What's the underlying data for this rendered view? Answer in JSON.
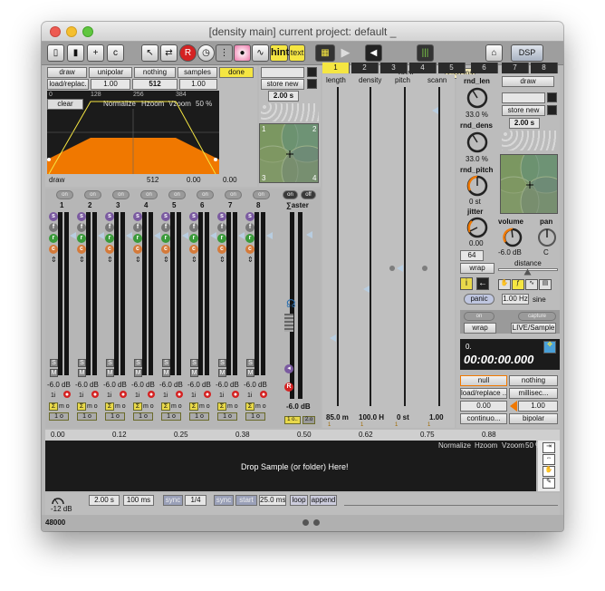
{
  "window": {
    "title": "[density main] current project:  default _"
  },
  "toolbar": {
    "hint": "hint",
    "text": "text",
    "post": "post",
    "post_ms": "25.0 ms",
    "dsp": "DSP"
  },
  "grain_panel": {
    "draw": "draw",
    "mode": "unipolar",
    "nothing": "nothing",
    "samples": "samples",
    "done": "done",
    "load_replace": "load/replac.",
    "value_1": "1.00",
    "value_512": "512",
    "value_1b": "1.00",
    "ruler": [
      "0",
      "128",
      "256",
      "384"
    ],
    "clear": "clear",
    "normalize": "Normalize",
    "hzoom": "Hzoom",
    "vzoom": "Vzoom",
    "zoom_pct": "50 %",
    "footer": [
      "draw",
      "512",
      "0.00",
      "0.00"
    ]
  },
  "preset_panel": {
    "store_new": "store new",
    "duration": "2.00 s",
    "corners": [
      "1",
      "2",
      "3",
      "4"
    ]
  },
  "param_tabs": [
    "1",
    "2",
    "3",
    "4",
    "5",
    "6",
    "7",
    "8"
  ],
  "params": {
    "names": [
      "length",
      "density",
      "pitch",
      "scann"
    ],
    "values": [
      "85.0 m",
      "100.0 H",
      "0 st",
      "1.00"
    ],
    "level": "1"
  },
  "mixer": {
    "on": "on",
    "off": "off",
    "master": "∑aster",
    "channels": [
      "1",
      "2",
      "3",
      "4",
      "5",
      "6",
      "7",
      "8"
    ],
    "levels": [
      "-6.0 dB",
      "-6.0 dB",
      "-6.0 dB",
      "-6.0 dB",
      "-6.0 dB",
      "-6.0 dB",
      "-6.0 dB",
      "-6.0 dB"
    ],
    "master_level": "-6.0 dB",
    "solo": "S",
    "mute": "M",
    "s": "s",
    "f": "f",
    "r": "r",
    "c": "c",
    "io": "1i",
    "mono": "m o",
    "stereo": "1 o",
    "master_out": "1 o..",
    "master_out2": "2.o"
  },
  "right_panel": {
    "rnd_len": "rnd_len",
    "rnd_len_val": "33.0 %",
    "rnd_dens": "rnd_dens",
    "rnd_dens_val": "33.0 %",
    "rnd_pitch": "rnd_pitch",
    "rnd_pitch_val": "0 st",
    "jitter": "jitter",
    "jitter_val": "0.00",
    "draw": "draw",
    "store_new": "store new",
    "duration": "2.00 s",
    "volume": "volume",
    "volume_val": "-6.0 dB",
    "pan": "pan",
    "pan_val": "C",
    "distance": "distance",
    "voices": "64",
    "wrap": "wrap",
    "panic": "panic",
    "lfo_rate": "1.00 Hz",
    "lfo_shape": "sine",
    "on": "on",
    "capture": "capture",
    "live_sample": "LIVE/Sample",
    "wrap2": "wrap",
    "counter": "0.",
    "timecode": "00:00:00.000",
    "null": "null",
    "nothing": "nothing",
    "load_replace": "load/replace ..",
    "millisec": "millisec...",
    "v0": "0.00",
    "v1": "1.00",
    "continuous": "continuo...",
    "bipolar": "bipolar"
  },
  "sample_panel": {
    "ruler": [
      "0.00",
      "0.12",
      "0.25",
      "0.38",
      "0.50",
      "0.62",
      "0.75",
      "0.88"
    ],
    "normalize": "Normalize",
    "hzoom": "Hzoom",
    "vzoom": "Vzoom",
    "zoom_pct": "50 %",
    "drop": "Drop Sample (or folder) Here!"
  },
  "bottom_bar": {
    "gain": "-12 dB",
    "dur1": "2.00 s",
    "dur2": "100 ms",
    "sync": "sync",
    "ratio": "1/4",
    "sync2": "sync",
    "start": "start",
    "ms": "25.0 ms",
    "loop": "loop",
    "append": "append",
    "rate": "48000"
  },
  "colors": {
    "accent": "#f07800",
    "yellow": "#f5e642",
    "dark": "#1b1b1b",
    "panel": "#bdbdbd",
    "xy_green": "#7f9a6a"
  }
}
